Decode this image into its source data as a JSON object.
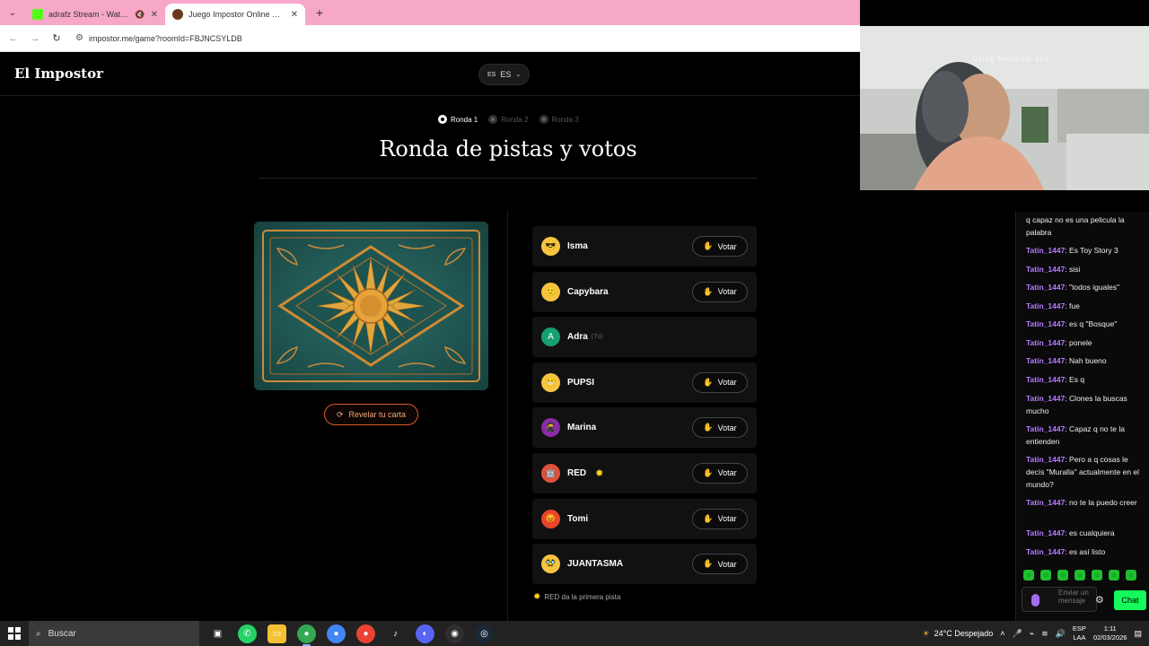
{
  "browser": {
    "tabs": [
      {
        "title": "adrafz Stream - Watch Live",
        "muted": true,
        "active": false
      },
      {
        "title": "Juego Impostor Online Gratis",
        "muted": false,
        "active": true
      }
    ],
    "url": "impostor.me/game?roomId=FBJNCSYLDB"
  },
  "app": {
    "logo": "El Impostor",
    "lang_flag": "ES",
    "lang_code": "ES"
  },
  "rounds": [
    {
      "label": "Ronda 1",
      "active": true
    },
    {
      "label": "Ronda 2",
      "active": false
    },
    {
      "label": "Ronda 3",
      "active": false
    }
  ],
  "title": "Ronda de pistas y votos",
  "reveal_label": "Revelar tu carta",
  "vote_label": "Votar",
  "players": [
    {
      "name": "Isma",
      "avatar": "sunglasses-emoji",
      "avatar_color": "#f5c542",
      "you": "",
      "has_sun": false,
      "can_vote": true
    },
    {
      "name": "Capybara",
      "avatar": "smile-emoji",
      "avatar_color": "#f5c542",
      "you": "",
      "has_sun": false,
      "can_vote": true
    },
    {
      "name": "Adra",
      "avatar_letter": "A",
      "avatar_color": "#15a06f",
      "you": "(Tú)",
      "has_sun": false,
      "can_vote": false
    },
    {
      "name": "PUPSI",
      "avatar": "grimace-emoji",
      "avatar_color": "#f5c542",
      "you": "",
      "has_sun": false,
      "can_vote": true
    },
    {
      "name": "Marina",
      "avatar": "ninja-emoji",
      "avatar_color": "#8a2aa8",
      "you": "",
      "has_sun": false,
      "can_vote": true
    },
    {
      "name": "RED",
      "avatar": "robot-emoji",
      "avatar_color": "#e0503a",
      "you": "",
      "has_sun": true,
      "can_vote": true
    },
    {
      "name": "Tomi",
      "avatar": "red-face-emoji",
      "avatar_color": "#e8452c",
      "you": "",
      "has_sun": false,
      "can_vote": true
    },
    {
      "name": "JUANTASMA",
      "avatar": "bandit-emoji",
      "avatar_color": "#f5c542",
      "you": "",
      "has_sun": false,
      "can_vote": true
    }
  ],
  "hint": "RED da la primera pista",
  "stream": {
    "watermark": "using Reincam.app"
  },
  "chat": {
    "messages": [
      {
        "user": "",
        "text": "q capaz no es una pelicula la palabra"
      },
      {
        "user": "Tatin_1447",
        "text": "Es Toy Story 3"
      },
      {
        "user": "Tatin_1447",
        "text": "sisi"
      },
      {
        "user": "Tatin_1447",
        "text": "\"todos iguales\""
      },
      {
        "user": "Tatin_1447",
        "text": "fue"
      },
      {
        "user": "Tatin_1447",
        "text": "es q \"Bosque\""
      },
      {
        "user": "Tatin_1447",
        "text": "ponele"
      },
      {
        "user": "Tatin_1447",
        "text": "Nah bueno"
      },
      {
        "user": "Tatin_1447",
        "text": "Es q"
      },
      {
        "user": "Tatin_1447",
        "text": "Clones la buscas mucho"
      },
      {
        "user": "Tatin_1447",
        "text": "Capaz q no te la entienden"
      },
      {
        "user": "Tatin_1447",
        "text": "Pero a q cosas le decís \"Muralla\" actualmente en el mundo?"
      },
      {
        "user": "Tatin_1447",
        "text": "no te la puedo creer"
      },
      {
        "user": "Tatin_1447",
        "text": "es cualquiera"
      },
      {
        "user": "Tatin_1447",
        "text": "es así listo"
      }
    ],
    "input_placeholder": "Enviar un mensaje",
    "send_label": "Chat"
  },
  "taskbar": {
    "search_placeholder": "Buscar",
    "weather": "24°C Despejado",
    "lang_line1": "ESP",
    "lang_line2": "LAA",
    "time": "1:11",
    "date": "02/03/2026"
  }
}
